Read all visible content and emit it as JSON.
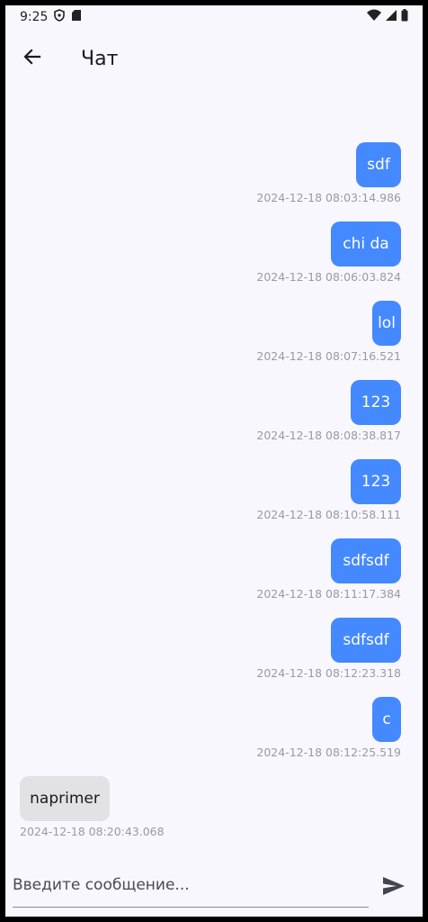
{
  "status_bar": {
    "time": "9:25",
    "icons_left": [
      "shield-icon",
      "sd-card-icon"
    ],
    "icons_right": [
      "wifi-icon",
      "signal-icon",
      "battery-icon"
    ]
  },
  "app_bar": {
    "back_icon": "arrow-left-icon",
    "title": "Чат"
  },
  "colors": {
    "outgoing_bubble": "#4489ff",
    "incoming_bubble": "#e2e2e4",
    "background": "#f8f7fd"
  },
  "messages": [
    {
      "text": "sdf",
      "timestamp": "2024-12-18 08:03:14.986",
      "direction": "outgoing"
    },
    {
      "text": "chi da",
      "timestamp": "2024-12-18 08:06:03.824",
      "direction": "outgoing"
    },
    {
      "text": "lol",
      "timestamp": "2024-12-18 08:07:16.521",
      "direction": "outgoing"
    },
    {
      "text": "123",
      "timestamp": "2024-12-18 08:08:38.817",
      "direction": "outgoing"
    },
    {
      "text": "123",
      "timestamp": "2024-12-18 08:10:58.111",
      "direction": "outgoing"
    },
    {
      "text": "sdfsdf",
      "timestamp": "2024-12-18 08:11:17.384",
      "direction": "outgoing"
    },
    {
      "text": "sdfsdf",
      "timestamp": "2024-12-18 08:12:23.318",
      "direction": "outgoing"
    },
    {
      "text": "c",
      "timestamp": "2024-12-18 08:12:25.519",
      "direction": "outgoing"
    },
    {
      "text": "naprimer",
      "timestamp": "2024-12-18 08:20:43.068",
      "direction": "incoming"
    }
  ],
  "composer": {
    "value": "",
    "placeholder": "Введите сообщение...",
    "send_icon": "send-icon"
  }
}
